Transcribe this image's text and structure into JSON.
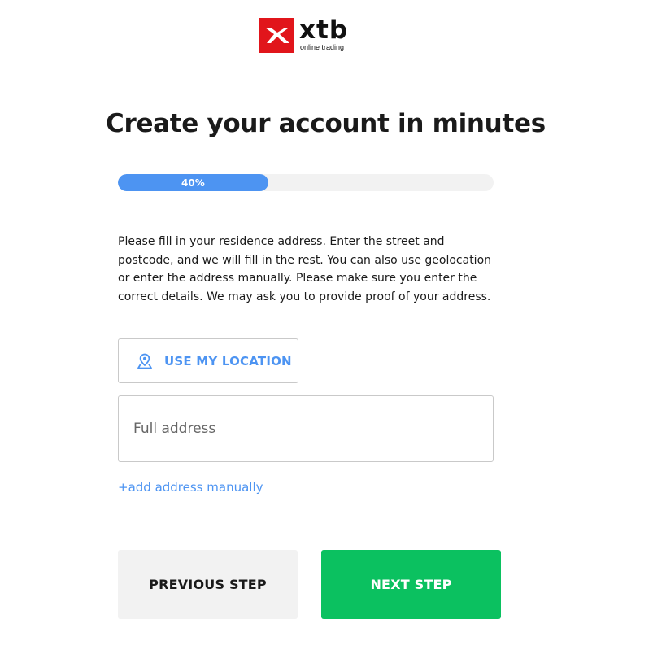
{
  "brand": {
    "name": "xtb",
    "tagline": "online trading",
    "color": "#e1151b",
    "icon": "xtb-x-logo-icon"
  },
  "page": {
    "title": "Create your account in minutes"
  },
  "progress": {
    "percent": 40,
    "label": "40%",
    "color": "#4d94f2"
  },
  "address_step": {
    "description": "Please fill in your residence address. Enter the street and postcode, and we will fill in the rest. You can also use geolocation or enter the address manually. Please make sure you enter the correct details. We may ask you to provide proof of your address.",
    "location_button": {
      "label": "USE MY LOCATION",
      "icon": "map-pin-icon"
    },
    "address_field": {
      "placeholder": "Full address",
      "value": ""
    },
    "manual_link": "+add address manually"
  },
  "navigation": {
    "previous_label": "PREVIOUS STEP",
    "next_label": "NEXT STEP",
    "next_color": "#0bc160"
  }
}
